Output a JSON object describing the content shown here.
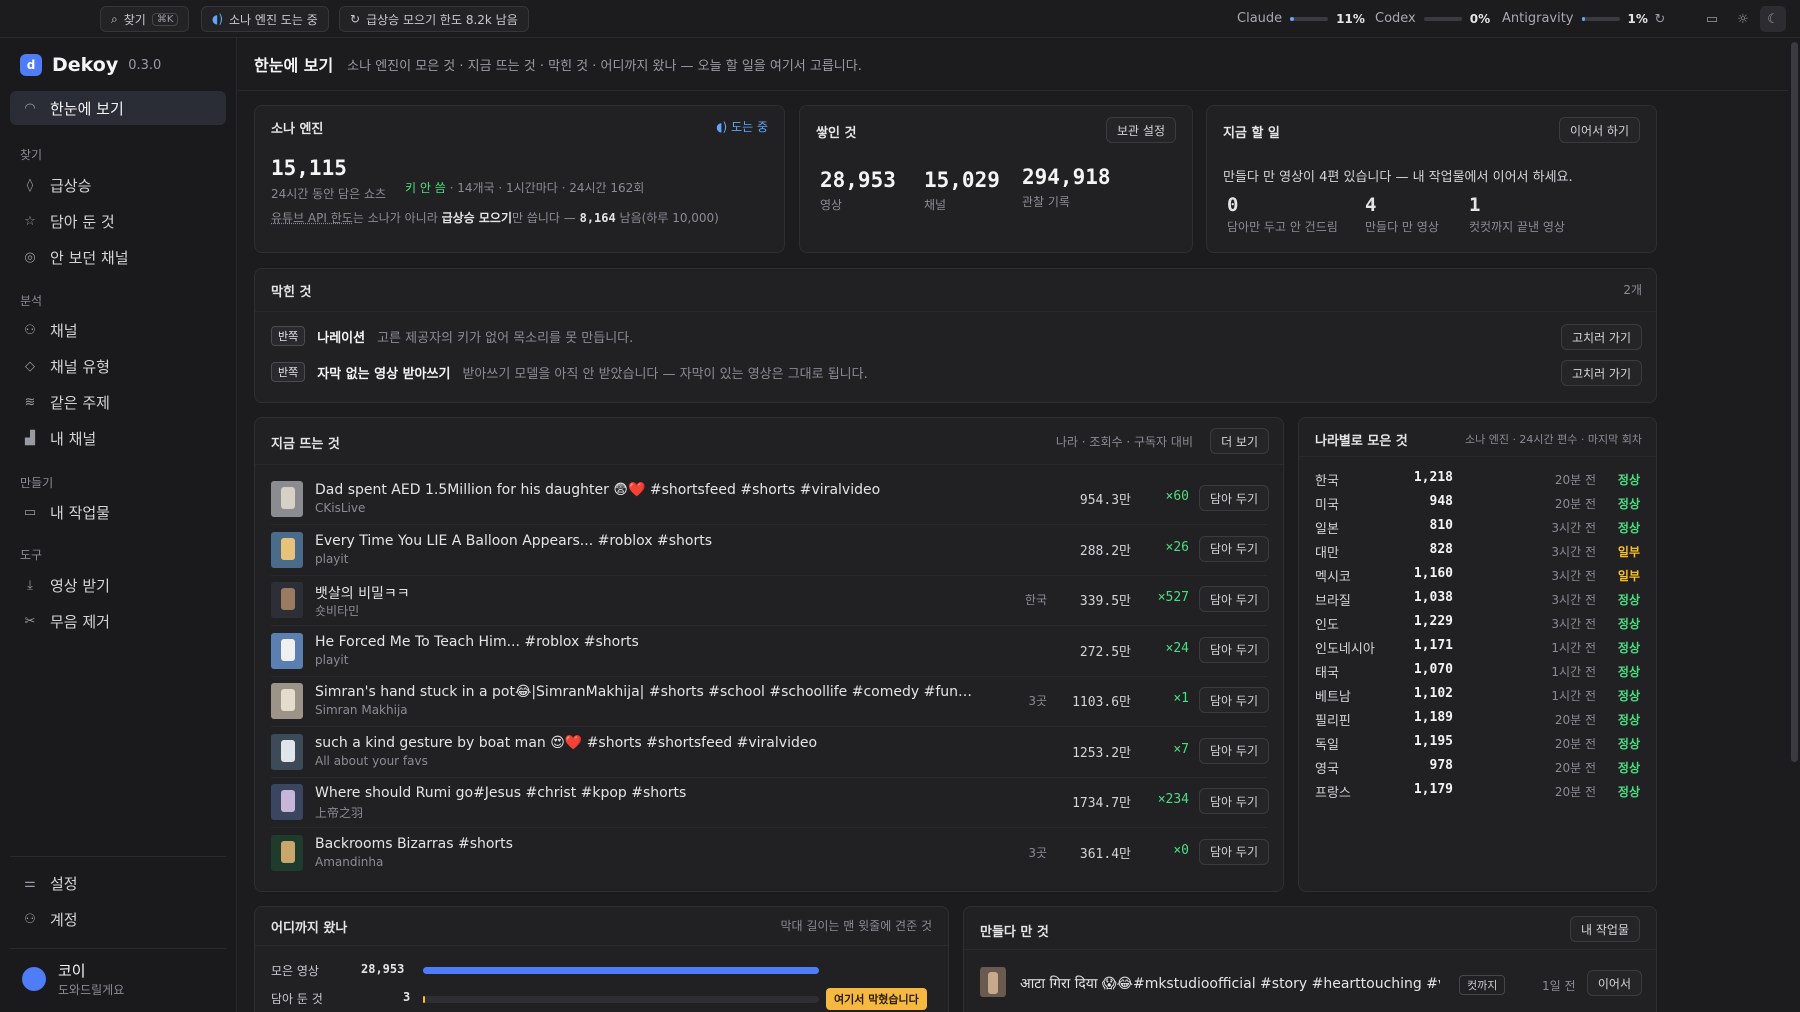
{
  "topbar": {
    "search_label": "찾기",
    "search_shortcut": "⌘K",
    "engine_status": "소나 엔진 도는 중",
    "quota_label": "급상승 모으기 한도 8.2k 남음",
    "usage": [
      {
        "name": "Claude",
        "pct": "11%",
        "value": 0.11
      },
      {
        "name": "Codex",
        "pct": "0%",
        "value": 0.0
      },
      {
        "name": "Antigravity",
        "pct": "1%",
        "value": 0.01
      }
    ]
  },
  "sidebar": {
    "brand": "Dekoy",
    "version": "0.3.0",
    "home": "한눈에 보기",
    "sections": {
      "find": "찾기",
      "analyze": "분석",
      "make": "만들기",
      "tools": "도구"
    },
    "find_items": [
      "급상승",
      "담아 둔 것",
      "안 보던 채널"
    ],
    "analyze_items": [
      "채널",
      "채널 유형",
      "같은 주제",
      "내 채널"
    ],
    "make_items": [
      "내 작업물"
    ],
    "tool_items": [
      "영상 받기",
      "무음 제거"
    ],
    "bottom_items": [
      "설정",
      "계정"
    ],
    "user_name": "코이",
    "user_sub": "도와드릴게요"
  },
  "page": {
    "title": "한눈에 보기",
    "desc": "소나 엔진이 모은 것 · 지금 뜨는 것 · 막힌 것 · 어디까지 왔나 — 오늘 할 일을 여기서 고릅니다."
  },
  "sonar": {
    "title": "소나 엔진",
    "status": "도는 중",
    "count": "15,115",
    "count_label": "24시간 동안 담은 쇼츠",
    "key_status": "키 안 씀",
    "meta": "· 14개국 · 1시간마다 · 24시간 162회",
    "note_prefix": "유튜브 API 한도",
    "note_mid": "는 소나가 아니라 ",
    "note_bold": "급상승 모으기",
    "note_mid2": "만 씁니다 — ",
    "note_num": "8,164",
    "note_suffix": " 남음(하루 10,000)"
  },
  "stacked": {
    "title": "쌓인 것",
    "button": "보관 설정",
    "stats": [
      {
        "value": "28,953",
        "label": "영상"
      },
      {
        "value": "15,029",
        "label": "채널"
      },
      {
        "value": "294,918",
        "label": "관찰 기록"
      }
    ]
  },
  "todo": {
    "title": "지금 할 일",
    "button": "이어서 하기",
    "message": "만들다 만 영상이 4편 있습니다 — 내 작업물에서 이어서 하세요.",
    "stats": [
      {
        "value": "0",
        "label": "담아만 두고 안 건드림"
      },
      {
        "value": "4",
        "label": "만들다 만 영상"
      },
      {
        "value": "1",
        "label": "컷컷까지 끝낸 영상"
      }
    ]
  },
  "blocked": {
    "title": "막힌 것",
    "count": "2개",
    "items": [
      {
        "badge": "반쪽",
        "name": "나레이션",
        "desc": "고른 제공자의 키가 없어 목소리를 못 만듭니다.",
        "action": "고치러 가기"
      },
      {
        "badge": "반쪽",
        "name": "자막 없는 영상 받아쓰기",
        "desc": "받아쓰기 모델을 아직 안 받았습니다 — 자막이 있는 영상은 그대로 됩니다.",
        "action": "고치러 가기"
      }
    ]
  },
  "trending": {
    "title": "지금 뜨는 것",
    "columns_hint": "나라 · 조회수 · 구독자 대비",
    "more": "더 보기",
    "save_label": "담아 두기",
    "rows": [
      {
        "title": "Dad spent AED 1.5Million for his daughter 😨❤️ #shortsfeed #shorts #viralvideo",
        "channel": "CKisLive",
        "country": "",
        "views": "954.3만",
        "ratio": "×60"
      },
      {
        "title": "Every Time You LIE A Balloon Appears... #roblox #shorts",
        "channel": "playit",
        "country": "",
        "views": "288.2만",
        "ratio": "×26"
      },
      {
        "title": "뱃살의 비밀ㅋㅋ",
        "channel": "숏비타민",
        "country": "한국",
        "views": "339.5만",
        "ratio": "×527"
      },
      {
        "title": "He Forced Me To Teach Him... #roblox #shorts",
        "channel": "playit",
        "country": "",
        "views": "272.5만",
        "ratio": "×24"
      },
      {
        "title": "Simran's hand stuck in a pot😂|SimranMakhija| #shorts #school #schoollife #comedy #funny #sa...",
        "channel": "Simran Makhija",
        "country": "3곳",
        "views": "1103.6만",
        "ratio": "×1"
      },
      {
        "title": "such a kind gesture by boat man 😍❤️ #shorts #shortsfeed #viralvideo",
        "channel": "All about your favs",
        "country": "",
        "views": "1253.2만",
        "ratio": "×7"
      },
      {
        "title": "Where should Rumi go#Jesus #christ #kpop #shorts",
        "channel": "上帝之羽",
        "country": "",
        "views": "1734.7만",
        "ratio": "×234"
      },
      {
        "title": "Backrooms Bizarras #shorts",
        "channel": "Amandinha",
        "country": "3곳",
        "views": "361.4만",
        "ratio": "×0"
      }
    ]
  },
  "countries": {
    "title": "나라별로 모은 것",
    "hint": "소나 엔진 · 24시간 편수 · 마지막 회차",
    "rows": [
      {
        "name": "한국",
        "count": "1,218",
        "ago": "20분 전",
        "status": "정상"
      },
      {
        "name": "미국",
        "count": "948",
        "ago": "20분 전",
        "status": "정상"
      },
      {
        "name": "일본",
        "count": "810",
        "ago": "3시간 전",
        "status": "정상"
      },
      {
        "name": "대만",
        "count": "828",
        "ago": "3시간 전",
        "status": "일부"
      },
      {
        "name": "멕시코",
        "count": "1,160",
        "ago": "3시간 전",
        "status": "일부"
      },
      {
        "name": "브라질",
        "count": "1,038",
        "ago": "3시간 전",
        "status": "정상"
      },
      {
        "name": "인도",
        "count": "1,229",
        "ago": "3시간 전",
        "status": "정상"
      },
      {
        "name": "인도네시아",
        "count": "1,171",
        "ago": "1시간 전",
        "status": "정상"
      },
      {
        "name": "태국",
        "count": "1,070",
        "ago": "1시간 전",
        "status": "정상"
      },
      {
        "name": "베트남",
        "count": "1,102",
        "ago": "1시간 전",
        "status": "정상"
      },
      {
        "name": "필리핀",
        "count": "1,189",
        "ago": "20분 전",
        "status": "정상"
      },
      {
        "name": "독일",
        "count": "1,195",
        "ago": "20분 전",
        "status": "정상"
      },
      {
        "name": "영국",
        "count": "978",
        "ago": "20분 전",
        "status": "정상"
      },
      {
        "name": "프랑스",
        "count": "1,179",
        "ago": "20분 전",
        "status": "정상"
      }
    ]
  },
  "progress": {
    "title": "어디까지 왔나",
    "hint": "막대 길이는 맨 윗줄에 견준 것",
    "rows": [
      {
        "label": "모은 영상",
        "value": "28,953",
        "fraction": 1.0
      },
      {
        "label": "담아 둔 것",
        "value": "3",
        "fraction": 0.0001,
        "flag": "여기서 막혔습니다"
      }
    ]
  },
  "wip": {
    "title": "만들다 만 것",
    "button": "내 작업물",
    "rows": [
      {
        "title": "आटा गिरा दिया 😱😂#mkstudioofficial #story #hearttouching #viral...",
        "stage": "컷까지",
        "ago": "1일 전",
        "action": "이어서"
      }
    ]
  },
  "colors": {
    "accent": "#60a5fa",
    "ok": "#4ade80",
    "warn": "#fbbf24",
    "progress_bar": "#4f7cf7"
  }
}
